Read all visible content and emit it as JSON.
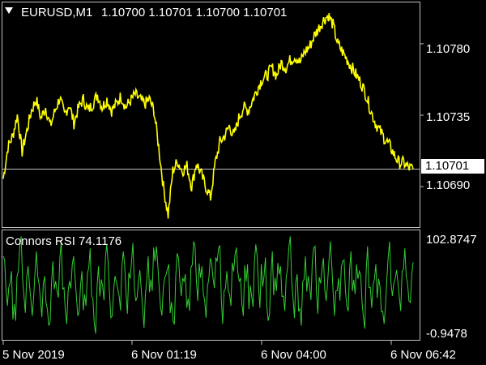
{
  "header": {
    "symbol": "EURUSD,M1",
    "ohlc": "1.10700 1.10701 1.10700 1.10701"
  },
  "indicator": {
    "label": "Connors RSI 74.1176"
  },
  "price_axis": {
    "ticks": [
      "1.10780",
      "1.10735",
      "1.10690"
    ],
    "current": "1.10701"
  },
  "rsi_axis": {
    "top": "102.8747",
    "bottom": "-0.9478"
  },
  "time_axis": {
    "ticks": [
      "5 Nov 2019",
      "6 Nov 01:19",
      "6 Nov 04:00",
      "6 Nov 06:42"
    ]
  },
  "colors": {
    "background": "#000000",
    "price_line": "#ffff00",
    "rsi_line": "#33cc33",
    "axis": "#c0c0c0"
  },
  "chart_data": [
    {
      "type": "line",
      "title": "EURUSD,M1",
      "series": [
        {
          "name": "EURUSD,M1",
          "values": [
            1.10695,
            1.10715,
            1.10722,
            1.10735,
            1.10712,
            1.10725,
            1.10738,
            1.10745,
            1.10733,
            1.1074,
            1.10728,
            1.10738,
            1.10746,
            1.10735,
            1.10742,
            1.1073,
            1.1074,
            1.10745,
            1.10738,
            1.10742,
            1.10748,
            1.1074,
            1.10745,
            1.10738,
            1.10742,
            1.10747,
            1.1074,
            1.10744,
            1.10748,
            1.10745,
            1.10742,
            1.10745,
            1.10738,
            1.10715,
            1.1069,
            1.10672,
            1.107,
            1.10706,
            1.107,
            1.10703,
            1.1069,
            1.10705,
            1.10698,
            1.1069,
            1.10683,
            1.10705,
            1.10718,
            1.10722,
            1.10728,
            1.10722,
            1.10733,
            1.1074,
            1.10738,
            1.10745,
            1.10752,
            1.10758,
            1.1076,
            1.10765,
            1.1076,
            1.10768,
            1.10765,
            1.1077,
            1.10772,
            1.10768,
            1.10775,
            1.10778,
            1.10785,
            1.1079,
            1.10795,
            1.10798,
            1.10792,
            1.1078,
            1.10775,
            1.1077,
            1.10765,
            1.1076,
            1.10755,
            1.10748,
            1.10738,
            1.1073,
            1.10725,
            1.1072,
            1.10716,
            1.1071,
            1.10705,
            1.10705,
            1.10702,
            1.10701
          ]
        }
      ],
      "ylim": [
        1.10665,
        1.10805
      ],
      "yticks": [
        1.1069,
        1.10735,
        1.1078
      ],
      "xticks": [
        "5 Nov 2019",
        "6 Nov 01:19",
        "6 Nov 04:00",
        "6 Nov 06:42"
      ],
      "current_level": 1.10701
    },
    {
      "type": "line",
      "title": "Connors RSI 74.1176",
      "series": [
        {
          "name": "Connors RSI",
          "values": [
            80,
            30,
            65,
            15,
            90,
            40,
            70,
            20,
            85,
            35,
            60,
            10,
            75,
            45,
            95,
            25,
            55,
            80,
            20,
            65,
            30,
            88,
            12,
            70,
            50,
            92,
            18,
            60,
            40,
            85,
            22,
            75,
            35,
            66,
            8,
            80,
            45,
            90,
            28,
            58,
            72,
            15,
            83,
            40,
            62,
            25,
            95,
            35,
            70,
            18,
            78,
            48,
            88,
            12,
            65,
            30,
            82,
            55,
            20,
            72,
            40,
            92,
            28,
            60,
            15,
            85,
            45,
            70,
            25,
            90,
            38,
            62,
            10,
            80,
            50,
            88,
            22,
            68,
            35,
            95,
            20,
            58,
            75,
            30,
            85,
            42,
            65,
            18,
            90,
            28,
            72,
            50,
            12,
            80,
            40,
            66,
            25,
            88,
            35,
            74
          ]
        }
      ],
      "ylim": [
        -0.9478,
        102.8747
      ]
    }
  ]
}
